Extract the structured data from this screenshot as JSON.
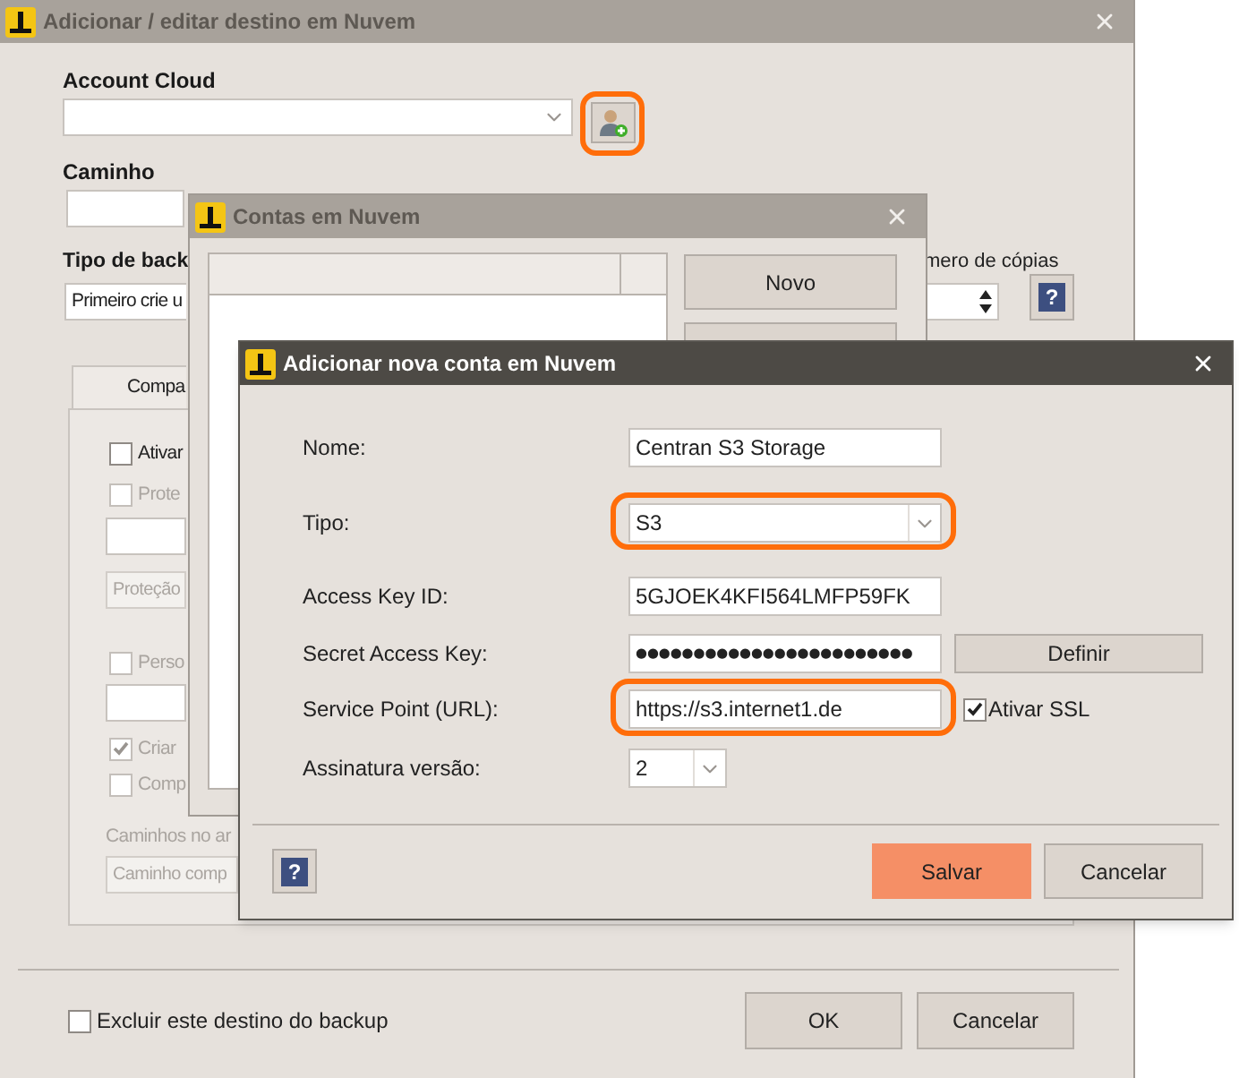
{
  "main_window": {
    "title": "Adicionar / editar destino em Nuvem",
    "active": false,
    "account_cloud": {
      "label": "Account Cloud",
      "highlighted": true
    },
    "path": {
      "label": "Caminho"
    },
    "backup_type": {
      "label": "Tipo de back",
      "value": "Primeiro crie u"
    },
    "copies": {
      "label": "mero de cópias",
      "help": "?"
    },
    "tab": {
      "label": "Compa",
      "selected": true
    },
    "options": [
      {
        "kind": "checkbox",
        "label": "Ativar",
        "checked": false,
        "disabled": false
      },
      {
        "kind": "checkbox",
        "label": "Prote",
        "checked": false,
        "disabled": true
      },
      {
        "kind": "field",
        "disabled": false
      },
      {
        "kind": "field",
        "value": "Proteção",
        "disabled": true
      },
      {
        "kind": "checkbox",
        "label": "Perso",
        "checked": false,
        "disabled": true
      },
      {
        "kind": "field",
        "disabled": false
      },
      {
        "kind": "checkbox",
        "label": "Criar",
        "checked": true,
        "disabled": true
      },
      {
        "kind": "checkbox",
        "label": "Comp",
        "checked": false,
        "disabled": true
      },
      {
        "kind": "label",
        "label": "Caminhos no ar"
      },
      {
        "kind": "field",
        "value": "Caminho comp",
        "disabled": true
      }
    ],
    "exclude": {
      "label": "Excluir este destino do backup",
      "checked": false
    },
    "buttons": [
      "OK",
      "Cancelar"
    ]
  },
  "accounts_window": {
    "title": "Contas em Nuvem",
    "active": false,
    "buttons": [
      "Novo"
    ]
  },
  "dialog": {
    "title": "Adicionar nova conta em Nuvem",
    "active": true,
    "fields": [
      {
        "kind": "text",
        "label": "Nome:",
        "value": "Centran S3 Storage",
        "highlighted": false
      },
      {
        "kind": "select",
        "label": "Tipo:",
        "value": "S3",
        "highlighted": true
      },
      {
        "kind": "text",
        "label": "Access Key ID:",
        "value": "5GJOEK4KFI564LMFP59FK",
        "highlighted": false
      },
      {
        "kind": "password",
        "label": "Secret Access Key:",
        "value": "●●●●●●●●●●●●●●●●●●●●●●●●",
        "button": "Definir",
        "highlighted": false
      },
      {
        "kind": "text",
        "label": "Service Point (URL):",
        "value": "https://s3.internet1.de",
        "highlighted": true,
        "checkbox": {
          "label": "Ativar SSL",
          "checked": true
        }
      },
      {
        "kind": "small_select",
        "label": "Assinatura versão:",
        "value": "2",
        "highlighted": false
      }
    ],
    "help": "?",
    "buttons": [
      {
        "label": "Salvar",
        "primary": true
      },
      {
        "label": "Cancelar",
        "primary": false
      }
    ]
  }
}
